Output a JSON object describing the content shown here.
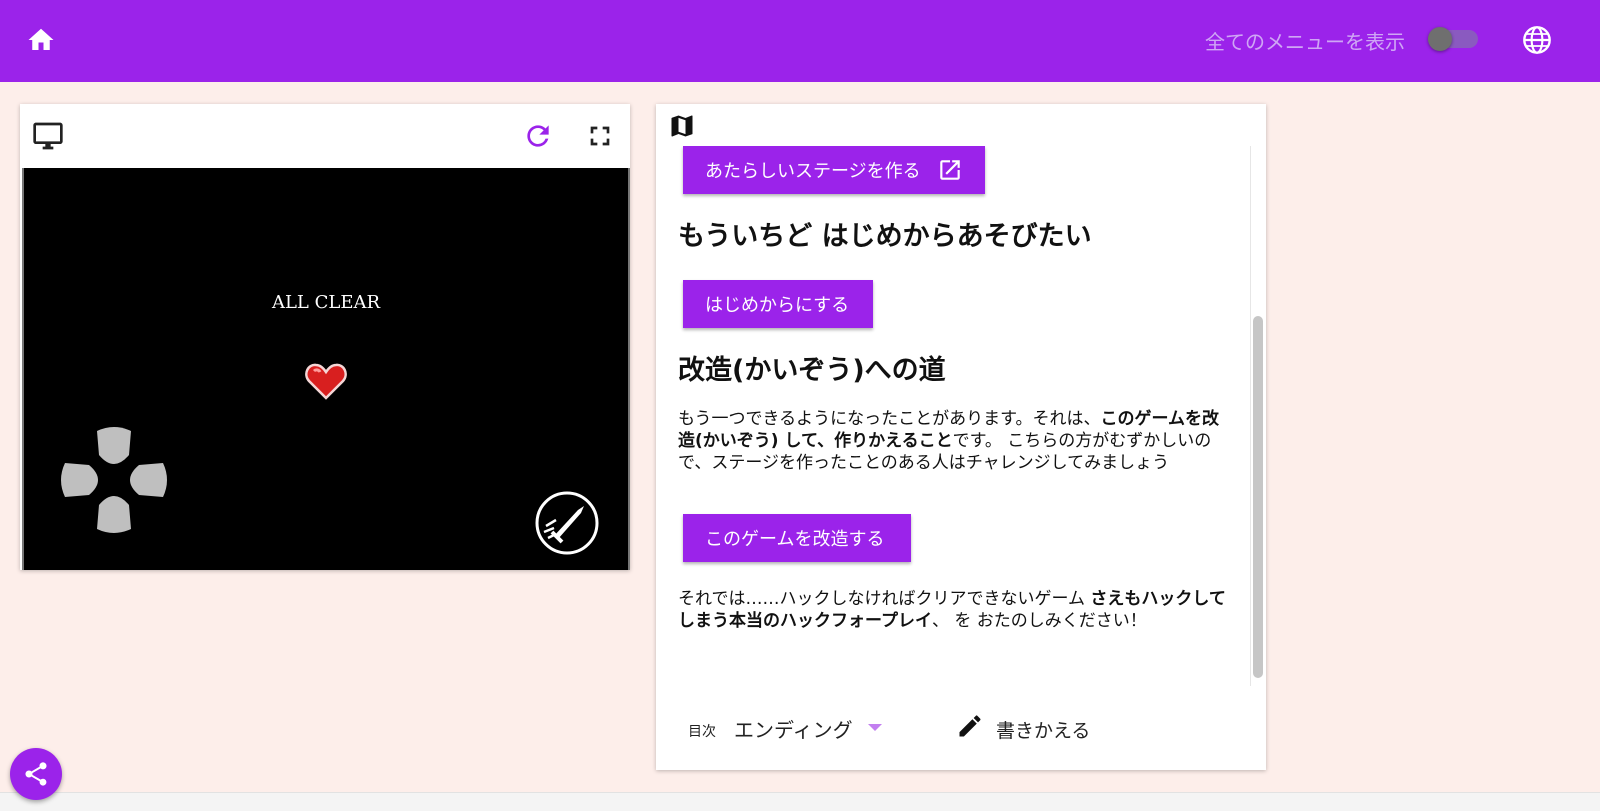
{
  "header": {
    "show_all_menu_label": "全てのメニューを表示",
    "show_all_menu_on": false,
    "home_icon": "home-icon",
    "globe_icon": "globe-icon"
  },
  "game": {
    "toolbar": {
      "monitor_icon": "monitor-icon",
      "reload_icon": "reload-icon",
      "fullscreen_icon": "fullscreen-icon"
    },
    "screen_text": "ALL CLEAR"
  },
  "doc": {
    "new_stage_button": "あたらしいステージを作る",
    "restart_heading": "もういちど はじめからあそびたい",
    "restart_button": "はじめからにする",
    "modding_heading": "改造(かいぞう)への道",
    "modding_para": {
      "t1": "もう一つできるようになったことがあります。それは、",
      "b1": "このゲームを改造(かいぞう) して、作りかえること",
      "t2": "です。 こちらの方がむずかしいので、ステージを作ったことのある人はチャレンジしてみましょう"
    },
    "modding_button": "このゲームを改造する",
    "closing_para": {
      "t1": "それでは……ハックしなければクリアできないゲーム ",
      "b1": "さえもハックしてしまう本当のハックフォープレイ",
      "t2": "、 を おたのしみください！"
    },
    "footer": {
      "toc_label": "目次",
      "toc_selected": "エンディング",
      "edit_label": "書きかえる"
    }
  },
  "colors": {
    "primary": "#9b23ea",
    "background": "#fdeeea"
  }
}
